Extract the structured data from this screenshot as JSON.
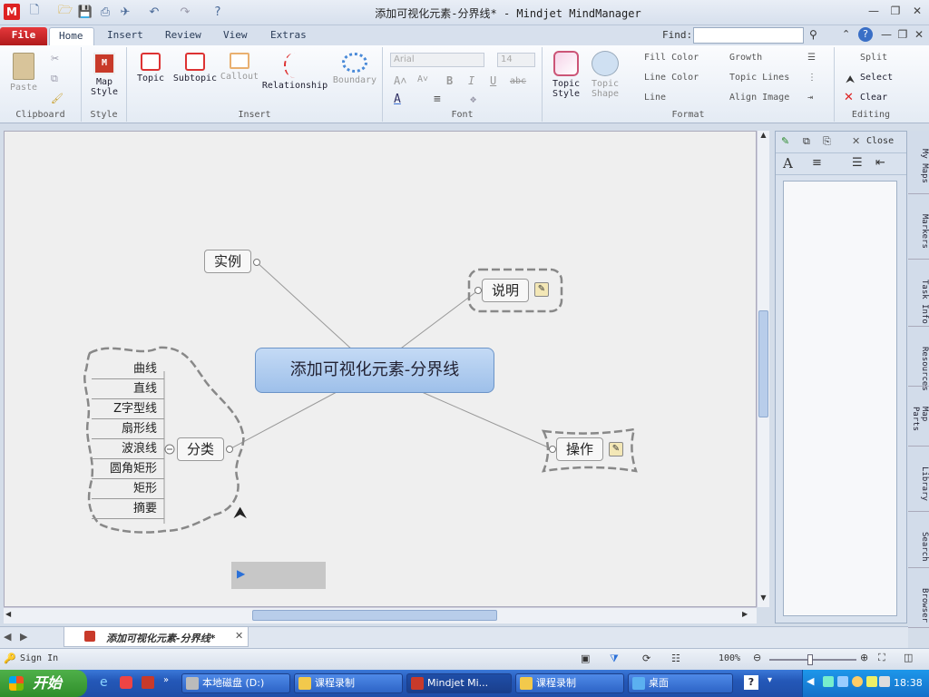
{
  "window": {
    "title": "添加可视化元素-分界线* - Mindjet MindManager",
    "find_label": "Find:"
  },
  "tabs": [
    {
      "label": "File"
    },
    {
      "label": "Home"
    },
    {
      "label": "Insert"
    },
    {
      "label": "Review"
    },
    {
      "label": "View"
    },
    {
      "label": "Extras"
    }
  ],
  "ribbon": {
    "clipboard": {
      "label": "Clipboard",
      "paste": "Paste"
    },
    "style": {
      "label": "Style",
      "map_style": "Map Style"
    },
    "insert": {
      "label": "Insert",
      "topic": "Topic",
      "subtopic": "Subtopic",
      "callout": "Callout",
      "relationship": "Relationship",
      "boundary": "Boundary"
    },
    "font": {
      "label": "Font",
      "font_name": "Arial",
      "font_size": "14"
    },
    "format": {
      "label": "Format",
      "topic_style": "Topic Style",
      "topic_shape": "Topic Shape",
      "fill_color": "Fill Color",
      "line_color": "Line Color",
      "line": "Line",
      "growth": "Growth",
      "topic_lines": "Topic Lines",
      "align_image": "Align Image"
    },
    "editing": {
      "label": "Editing",
      "split": "Split",
      "select": "Select",
      "clear": "Clear"
    }
  },
  "map": {
    "central": "添加可视化元素-分界线",
    "branches": {
      "example": "实例",
      "explanation": "说明",
      "operation": "操作",
      "category": "分类"
    },
    "subtopics": [
      "曲线",
      "直线",
      "Z字型线",
      "扇形线",
      "波浪线",
      "圆角矩形",
      "矩形",
      "摘要"
    ]
  },
  "taskpane": {
    "close": "Close"
  },
  "sidetabs": [
    "My Maps",
    "Markers",
    "Task Info",
    "Resources",
    "Map Parts",
    "Library",
    "Search",
    "Browser"
  ],
  "document_tab": "添加可视化元素-分界线*",
  "statusbar": {
    "sign_in": "Sign In",
    "zoom": "100%"
  },
  "taskbar": {
    "start": "开始",
    "items": [
      "本地磁盘 (D:)",
      "课程录制",
      "Mindjet Mi...",
      "课程录制",
      "桌面"
    ],
    "clock": "18:38"
  },
  "colors": {
    "central_fill": "#a9c8ef",
    "file_tab": "#c8262a",
    "taskbar": "#2458b8",
    "start_button": "#3a9c34"
  }
}
